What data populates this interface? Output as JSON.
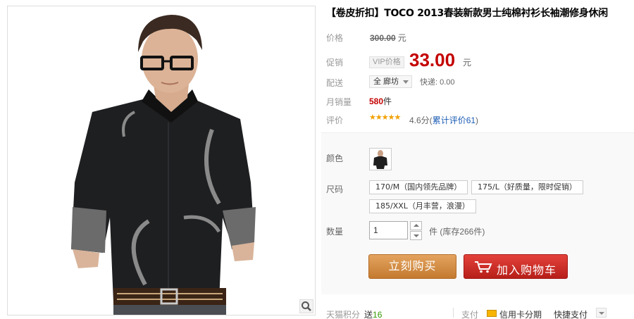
{
  "product": {
    "title": "【卷皮折扣】TOCO 2013春装新款男士纯棉衬衫长袖潮修身休闲"
  },
  "price": {
    "label": "价格",
    "original": "300.00",
    "currency": "元"
  },
  "promo": {
    "label": "促销",
    "tag": "VIP价格",
    "price": "33.00",
    "currency": "元"
  },
  "shipping": {
    "label": "配送",
    "region": "全 廊坊",
    "fee": "快递: 0.00"
  },
  "sales": {
    "label": "月销量",
    "count": "580",
    "unit": "件"
  },
  "rating": {
    "label": "评价",
    "stars": "★★★★★",
    "score": "4.6分(",
    "reviews_link": "累计评价61",
    "close": ")"
  },
  "sku": {
    "color_label": "颜色",
    "size_label": "尺码",
    "sizes": [
      "170/M（国内领先品牌）",
      "175/L（好质量，限时促销）",
      "185/XXL（月丰营，浪漫）"
    ],
    "qty_label": "数量",
    "qty_value": "1",
    "qty_unit": "件 (库存266件)"
  },
  "actions": {
    "buy_now": "立刻购买",
    "add_to_cart": "加入购物车"
  },
  "footer": {
    "points_label": "天猫积分",
    "points_give": "送",
    "points_value": "16",
    "pay_label": "支付",
    "credit_card": "信用卡分期",
    "quick_pay": "快捷支付"
  },
  "colors": {
    "promo_red": "#c40000",
    "buy_orange": "#d58c43",
    "cart_red": "#c62d27",
    "link_blue": "#1b5cb4",
    "star_gold": "#f1a100"
  }
}
